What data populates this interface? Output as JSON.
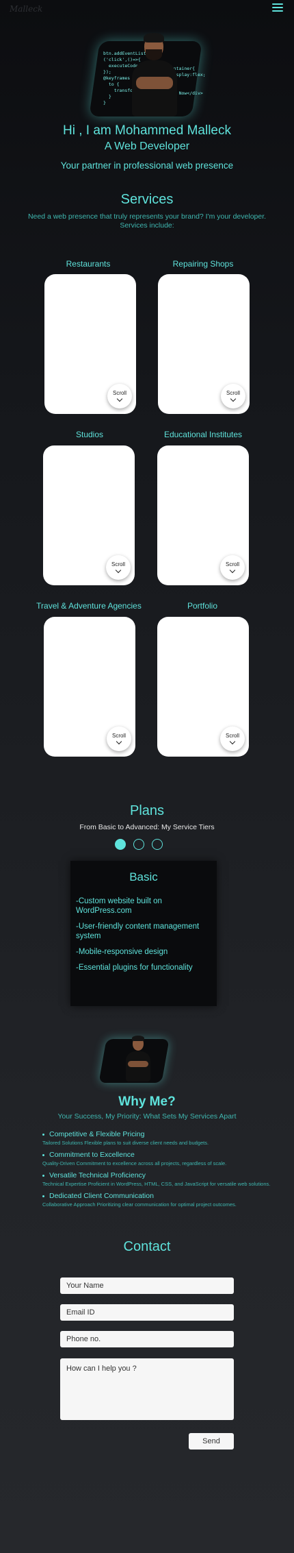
{
  "header": {
    "logo_text": "Malleck",
    "menu_icon": "hamburger-menu-icon"
  },
  "hero": {
    "code_lines": "btn.addEventListener\n('click',()=>{\n  executeCode();\n});\n@keyframes bounce {\n  to {\n    transform:\n  }\n}",
    "code_right": ".container{\n  display:flex;\n}\n\n</b> Now</div>",
    "greeting": "Hi , I am Mohammed Malleck",
    "role": "A Web Developer",
    "tagline": "Your partner in professional web presence"
  },
  "services": {
    "title": "Services",
    "description": "Need a web presence that truly represents your brand? I'm your developer. Services include:",
    "scroll_label": "Scroll",
    "items": [
      {
        "label": "Restaurants"
      },
      {
        "label": "Repairing Shops"
      },
      {
        "label": "Studios"
      },
      {
        "label": "Educational Institutes"
      },
      {
        "label": "Travel & Adventure Agencies"
      },
      {
        "label": "Portfolio"
      }
    ]
  },
  "plans": {
    "title": "Plans",
    "subtitle": "From Basic to Advanced: My Service Tiers",
    "active_index": 0,
    "card": {
      "title": "Basic",
      "features": [
        "-Custom website built on WordPress.com",
        "-User-friendly content management system",
        "-Mobile-responsive design",
        "-Essential plugins for functionality"
      ]
    }
  },
  "why": {
    "title": "Why Me?",
    "subtitle": "Your Success, My Priority: What Sets My Services Apart",
    "items": [
      {
        "heading": "Competitive & Flexible Pricing",
        "desc": "Tailored Solutions Flexible plans to suit diverse client needs and budgets."
      },
      {
        "heading": "Commitment to Excellence",
        "desc": "Quality-Driven Commitment to excellence across all projects, regardless of scale."
      },
      {
        "heading": "Versatile Technical Proficiency",
        "desc": "Technical Expertise Proficient in WordPress, HTML, CSS, and JavaScript for versatile web solutions."
      },
      {
        "heading": "Dedicated Client Communication",
        "desc": "Collaborative Approach Prioritizing clear communication for optimal project outcomes."
      }
    ]
  },
  "contact": {
    "title": "Contact",
    "name_placeholder": "Your Name",
    "email_placeholder": "Email ID",
    "phone_placeholder": "Phone no.",
    "message_placeholder": "How can I help you ?",
    "send_label": "Send"
  },
  "colors": {
    "accent": "#5fe3dc",
    "card": "#ffffff",
    "plan_card": "#0a0b0d"
  }
}
